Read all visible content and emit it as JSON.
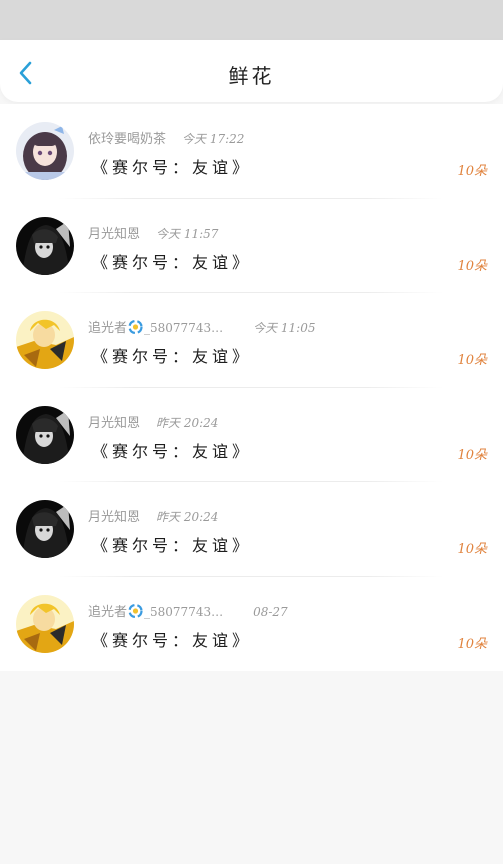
{
  "header": {
    "title": "鲜花"
  },
  "gifts": [
    {
      "name": "依玲要喝奶茶",
      "time": "今天 17:22",
      "gift": "《赛尔号：友谊》",
      "count": "10朵",
      "avatar": "light",
      "badge": false
    },
    {
      "name": "月光知恩",
      "time": "今天 11:57",
      "gift": "《赛尔号：友谊》",
      "count": "10朵",
      "avatar": "dark",
      "badge": false
    },
    {
      "name": "追光者",
      "name_suffix": "_58077743…",
      "time": "今天 11:05",
      "gift": "《赛尔号：友谊》",
      "count": "10朵",
      "avatar": "gold",
      "badge": true
    },
    {
      "name": "月光知恩",
      "time": "昨天 20:24",
      "gift": "《赛尔号：友谊》",
      "count": "10朵",
      "avatar": "dark",
      "badge": false
    },
    {
      "name": "月光知恩",
      "time": "昨天 20:24",
      "gift": "《赛尔号：友谊》",
      "count": "10朵",
      "avatar": "dark",
      "badge": false
    },
    {
      "name": "追光者",
      "name_suffix": "_58077743…",
      "time": "08-27",
      "gift": "《赛尔号：友谊》",
      "count": "10朵",
      "avatar": "gold",
      "badge": true
    }
  ],
  "colors": {
    "accent": "#2aa0d8",
    "count": "#e0823c",
    "meta": "#9a9a9a"
  },
  "icons": {
    "back": "chevron-left-icon",
    "badge": "swirl-badge-icon"
  }
}
